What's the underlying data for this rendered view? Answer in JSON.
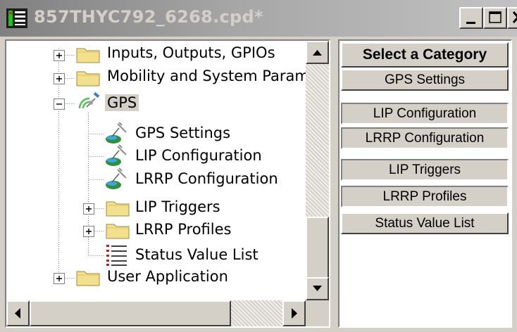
{
  "window": {
    "title": "857THYC792_6268.cpd*",
    "controls": {
      "minimize": "minimize",
      "maximize": "maximize",
      "close": "close"
    }
  },
  "tree": {
    "items": [
      {
        "label": "Inputs, Outputs, GPIOs",
        "icon": "folder-icon",
        "expander": "plus"
      },
      {
        "label": "Mobility and System Param",
        "icon": "folder-icon",
        "expander": "plus"
      },
      {
        "label": "GPS",
        "icon": "gps-satellite-icon",
        "expander": "minus",
        "selected": true
      },
      {
        "label": "GPS Settings",
        "icon": "gps-satellite-icon"
      },
      {
        "label": "LIP Configuration",
        "icon": "gps-satellite-icon"
      },
      {
        "label": "LRRP Configuration",
        "icon": "gps-satellite-icon"
      },
      {
        "label": "LIP Triggers",
        "icon": "folder-icon",
        "expander": "plus"
      },
      {
        "label": "LRRP Profiles",
        "icon": "folder-icon",
        "expander": "plus"
      },
      {
        "label": "Status Value List",
        "icon": "list-icon"
      },
      {
        "label": "User Application",
        "icon": "folder-icon",
        "expander": "plus"
      }
    ]
  },
  "category_panel": {
    "header": "Select a Category",
    "buttons": [
      {
        "label": "GPS Settings"
      },
      {
        "label": "LIP Configuration"
      },
      {
        "label": "LRRP Configuration"
      },
      {
        "label": "LIP Triggers"
      },
      {
        "label": "LRRP Profiles"
      },
      {
        "label": "Status Value List"
      }
    ]
  },
  "colors": {
    "titlebar_start": "#808080",
    "titlebar_end": "#c2c2c2",
    "face": "#d4d0c8",
    "folder": "#f3e08c",
    "satellite_dish": "#3a9a3a"
  }
}
